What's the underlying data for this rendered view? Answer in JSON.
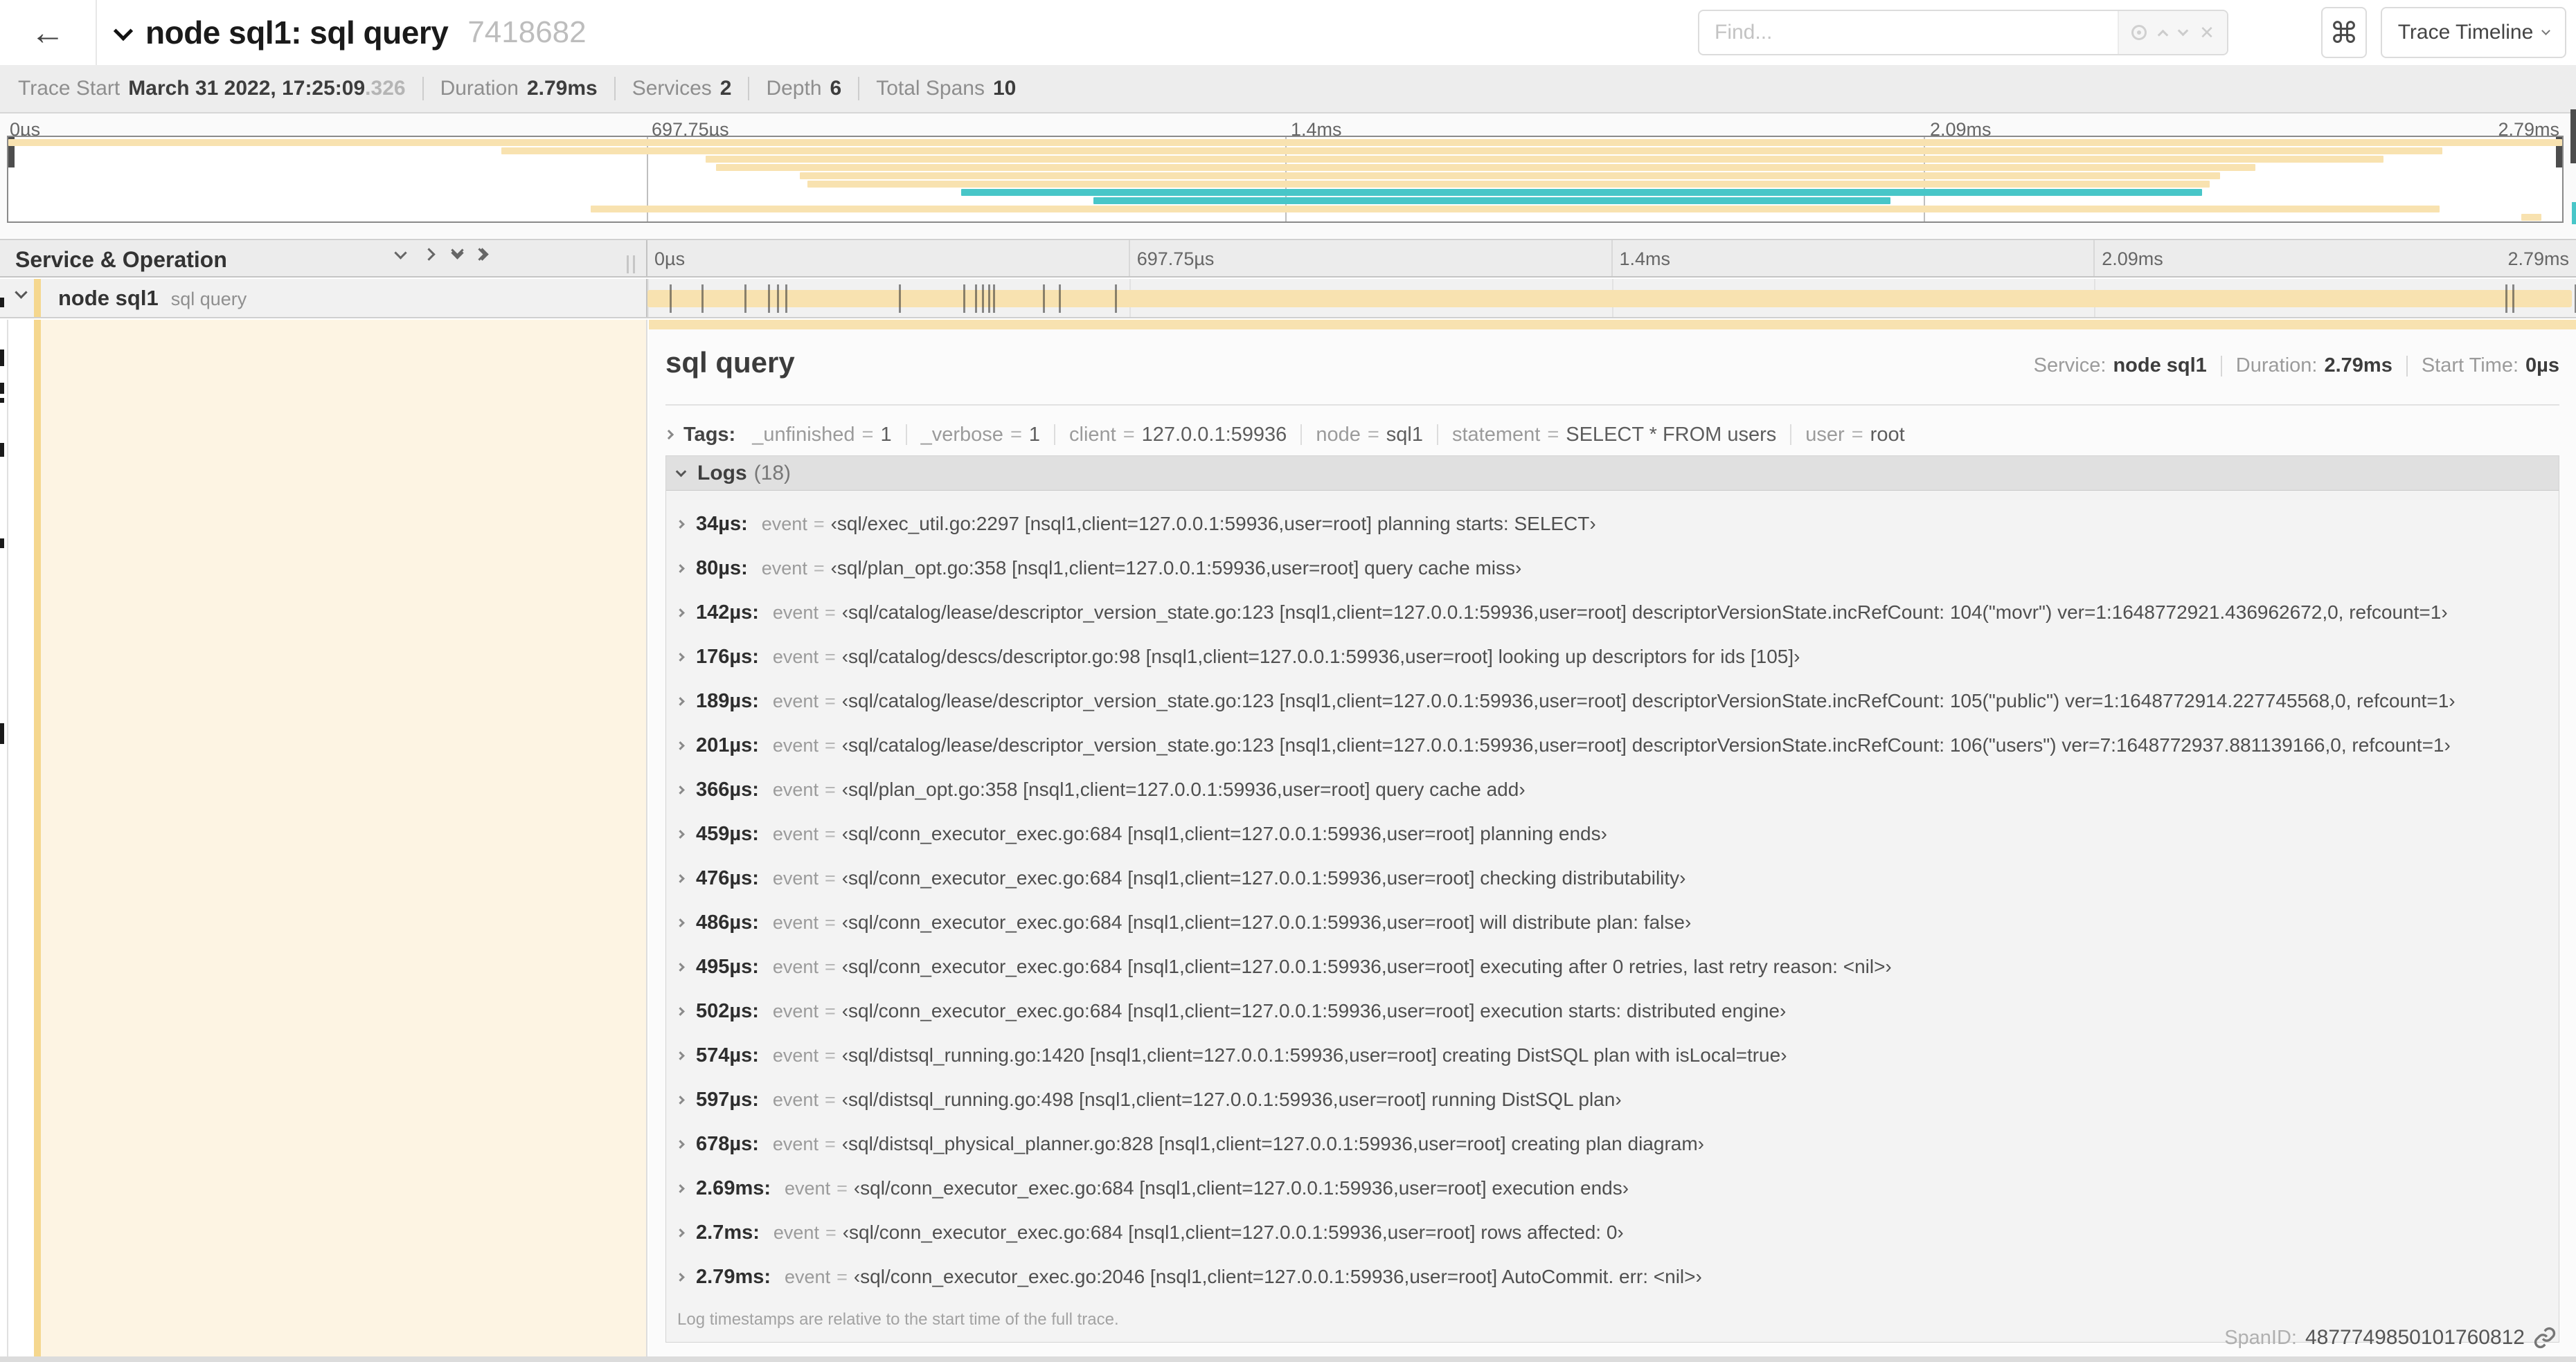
{
  "colors": {
    "span_tan": "#f8e2b0",
    "span_teal": "#48c6c8",
    "accent": "#f5d78e",
    "detail_bg": "#fdf4e3"
  },
  "header": {
    "back_icon": "←",
    "title": "node sql1: sql query",
    "trace_id": "7418682",
    "find_placeholder": "Find...",
    "shortcut_icon": "⌘",
    "view_selector_label": "Trace Timeline"
  },
  "summary": {
    "items": [
      {
        "label": "Trace Start",
        "value": "March 31 2022, 17:25:09",
        "value_suffix": ".326"
      },
      {
        "label": "Duration",
        "value": "2.79ms"
      },
      {
        "label": "Services",
        "value": "2"
      },
      {
        "label": "Depth",
        "value": "6"
      },
      {
        "label": "Total Spans",
        "value": "10"
      }
    ]
  },
  "minimap": {
    "ticks": [
      "0µs",
      "697.75µs",
      "1.4ms",
      "2.09ms",
      "2.79ms"
    ],
    "rows": [
      {
        "start": 0.0,
        "end": 1.0,
        "color": "tan"
      },
      {
        "start": 0.193,
        "end": 0.953,
        "color": "tan"
      },
      {
        "start": 0.273,
        "end": 0.93,
        "color": "tan"
      },
      {
        "start": 0.277,
        "end": 0.88,
        "color": "tan"
      },
      {
        "start": 0.31,
        "end": 0.866,
        "color": "tan"
      },
      {
        "start": 0.313,
        "end": 0.862,
        "color": "tan"
      },
      {
        "start": 0.373,
        "end": 0.859,
        "color": "teal"
      },
      {
        "start": 0.425,
        "end": 0.737,
        "color": "teal"
      },
      {
        "start": 0.228,
        "end": 0.952,
        "color": "tan"
      },
      {
        "start": 0.984,
        "end": 0.992,
        "color": "tan"
      }
    ]
  },
  "timeline": {
    "header_title": "Service & Operation",
    "ticks": [
      "0µs",
      "697.75µs",
      "1.4ms",
      "2.09ms",
      "2.79ms"
    ],
    "span": {
      "service": "node sql1",
      "operation": "sql query"
    }
  },
  "detail": {
    "title": "sql query",
    "overview": [
      {
        "label": "Service:",
        "value": "node sql1"
      },
      {
        "label": "Duration:",
        "value": "2.79ms"
      },
      {
        "label": "Start Time:",
        "value": "0µs"
      }
    ],
    "tags_label": "Tags:",
    "tags": [
      {
        "key": "_unfinished",
        "value": "1"
      },
      {
        "key": "_verbose",
        "value": "1"
      },
      {
        "key": "client",
        "value": "127.0.0.1:59936"
      },
      {
        "key": "node",
        "value": "sql1"
      },
      {
        "key": "statement",
        "value": "SELECT * FROM users"
      },
      {
        "key": "user",
        "value": "root"
      }
    ],
    "spanid_label": "SpanID:",
    "spanid_value": "4877749850101760812"
  },
  "logs": {
    "title": "Logs",
    "count": "(18)",
    "field_key": "event",
    "duration_us": 2790,
    "note": "Log timestamps are relative to the start time of the full trace.",
    "entries": [
      {
        "t_us": 34,
        "time": "34µs:",
        "value": "‹sql/exec_util.go:2297 [nsql1,client=127.0.0.1:59936,user=root] planning starts: SELECT›"
      },
      {
        "t_us": 80,
        "time": "80µs:",
        "value": "‹sql/plan_opt.go:358 [nsql1,client=127.0.0.1:59936,user=root] query cache miss›"
      },
      {
        "t_us": 142,
        "time": "142µs:",
        "value": "‹sql/catalog/lease/descriptor_version_state.go:123 [nsql1,client=127.0.0.1:59936,user=root] descriptorVersionState.incRefCount: 104(\"movr\") ver=1:1648772921.436962672,0, refcount=1›"
      },
      {
        "t_us": 176,
        "time": "176µs:",
        "value": "‹sql/catalog/descs/descriptor.go:98 [nsql1,client=127.0.0.1:59936,user=root] looking up descriptors for ids [105]›"
      },
      {
        "t_us": 189,
        "time": "189µs:",
        "value": "‹sql/catalog/lease/descriptor_version_state.go:123 [nsql1,client=127.0.0.1:59936,user=root] descriptorVersionState.incRefCount: 105(\"public\") ver=1:1648772914.227745568,0, refcount=1›"
      },
      {
        "t_us": 201,
        "time": "201µs:",
        "value": "‹sql/catalog/lease/descriptor_version_state.go:123 [nsql1,client=127.0.0.1:59936,user=root] descriptorVersionState.incRefCount: 106(\"users\") ver=7:1648772937.881139166,0, refcount=1›"
      },
      {
        "t_us": 366,
        "time": "366µs:",
        "value": "‹sql/plan_opt.go:358 [nsql1,client=127.0.0.1:59936,user=root] query cache add›"
      },
      {
        "t_us": 459,
        "time": "459µs:",
        "value": "‹sql/conn_executor_exec.go:684 [nsql1,client=127.0.0.1:59936,user=root] planning ends›"
      },
      {
        "t_us": 476,
        "time": "476µs:",
        "value": "‹sql/conn_executor_exec.go:684 [nsql1,client=127.0.0.1:59936,user=root] checking distributability›"
      },
      {
        "t_us": 486,
        "time": "486µs:",
        "value": "‹sql/conn_executor_exec.go:684 [nsql1,client=127.0.0.1:59936,user=root] will distribute plan: false›"
      },
      {
        "t_us": 495,
        "time": "495µs:",
        "value": "‹sql/conn_executor_exec.go:684 [nsql1,client=127.0.0.1:59936,user=root] executing after 0 retries, last retry reason: <nil>›"
      },
      {
        "t_us": 502,
        "time": "502µs:",
        "value": "‹sql/conn_executor_exec.go:684 [nsql1,client=127.0.0.1:59936,user=root] execution starts: distributed engine›"
      },
      {
        "t_us": 574,
        "time": "574µs:",
        "value": "‹sql/distsql_running.go:1420 [nsql1,client=127.0.0.1:59936,user=root] creating DistSQL plan with isLocal=true›"
      },
      {
        "t_us": 597,
        "time": "597µs:",
        "value": "‹sql/distsql_running.go:498 [nsql1,client=127.0.0.1:59936,user=root] running DistSQL plan›"
      },
      {
        "t_us": 678,
        "time": "678µs:",
        "value": "‹sql/distsql_physical_planner.go:828 [nsql1,client=127.0.0.1:59936,user=root] creating plan diagram›"
      },
      {
        "t_us": 2690,
        "time": "2.69ms:",
        "value": "‹sql/conn_executor_exec.go:684 [nsql1,client=127.0.0.1:59936,user=root] execution ends›"
      },
      {
        "t_us": 2700,
        "time": "2.7ms:",
        "value": "‹sql/conn_executor_exec.go:684 [nsql1,client=127.0.0.1:59936,user=root] rows affected: 0›"
      },
      {
        "t_us": 2790,
        "time": "2.79ms:",
        "value": "‹sql/conn_executor_exec.go:2046 [nsql1,client=127.0.0.1:59936,user=root] AutoCommit. err: <nil>›"
      }
    ]
  }
}
